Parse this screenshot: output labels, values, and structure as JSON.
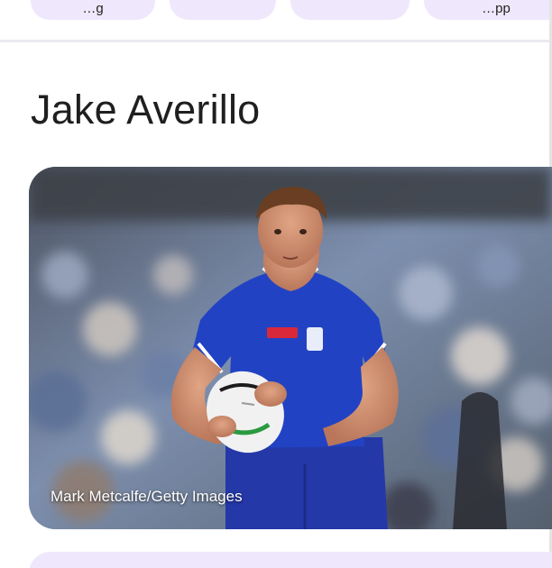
{
  "chips": [
    {
      "label": "…g"
    },
    {
      "label": ""
    },
    {
      "label": ""
    },
    {
      "label": "…pp"
    }
  ],
  "player": {
    "name": "Jake Averillo"
  },
  "photo": {
    "alt": "Jake Averillo running with the ball in a blue Bulldogs jersey",
    "credit": "Mark Metcalfe/Getty Images"
  },
  "colors": {
    "chip_bg": "#efe7fb",
    "jersey_blue": "#1f3fbf",
    "text": "#1f1f1f"
  }
}
